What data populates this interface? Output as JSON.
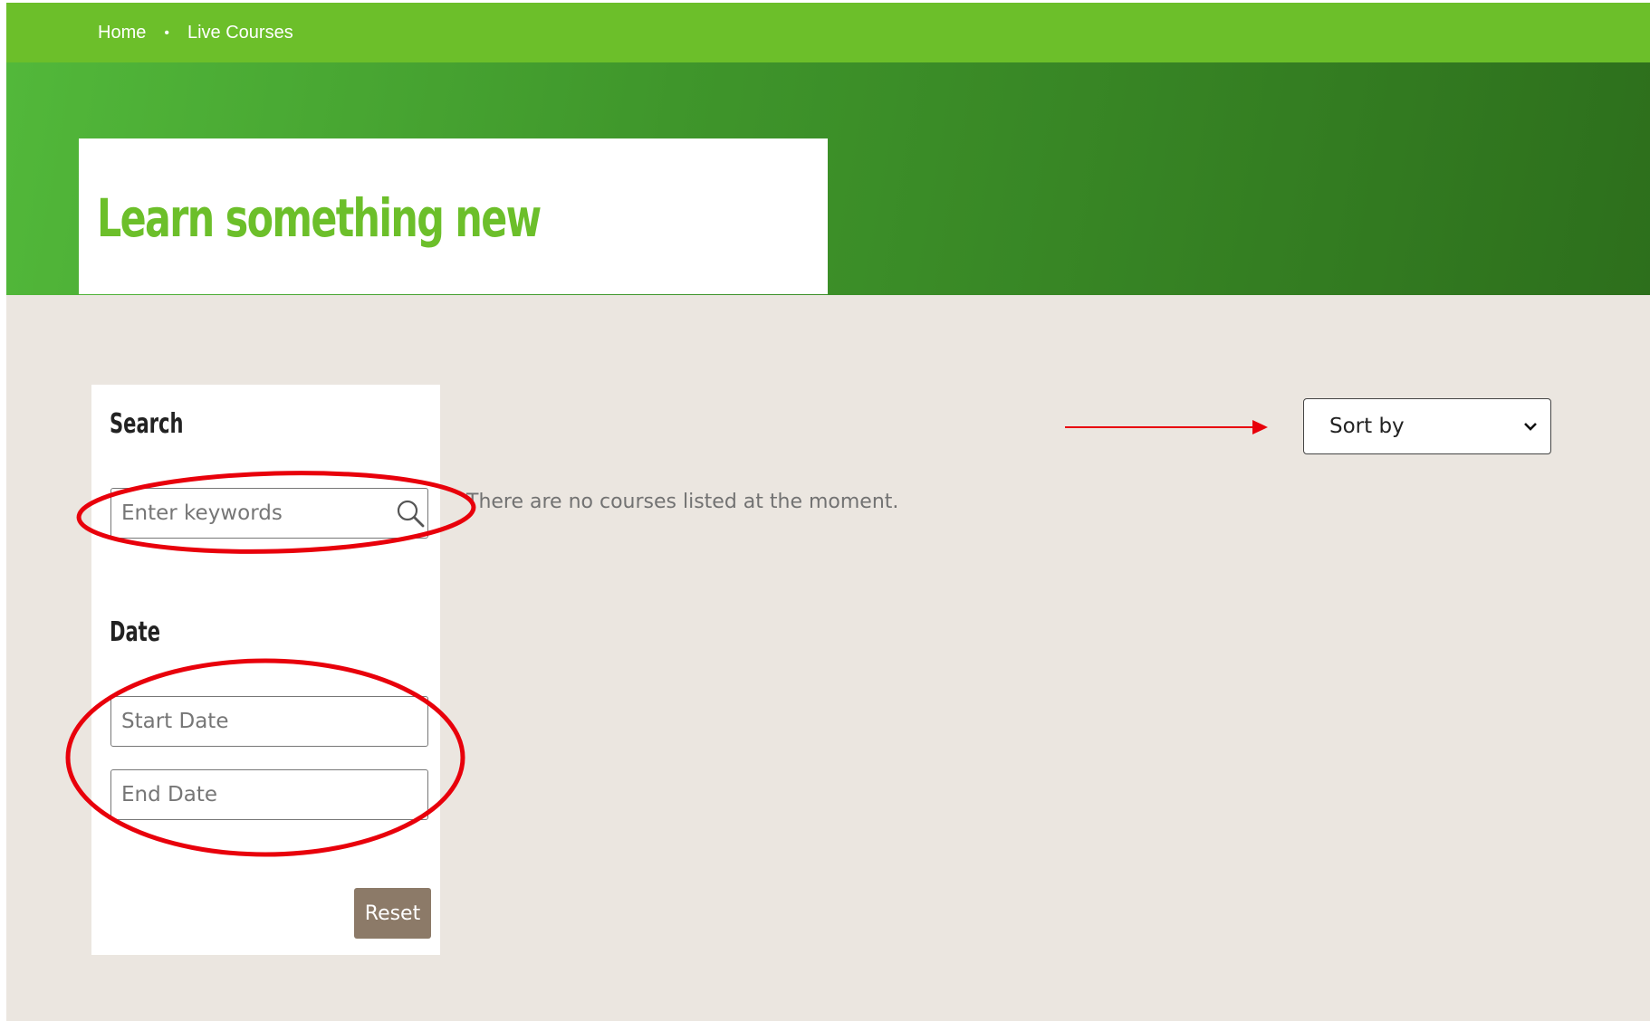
{
  "breadcrumb": {
    "home": "Home",
    "separator": "•",
    "current": "Live Courses"
  },
  "hero": {
    "title": "Learn something new"
  },
  "sidebar": {
    "search_heading": "Search",
    "search_placeholder": "Enter keywords",
    "date_heading": "Date",
    "start_date_placeholder": "Start Date",
    "end_date_placeholder": "End Date",
    "reset_label": "Reset"
  },
  "main": {
    "empty_message": "There are no courses listed at the moment.",
    "sort_label": "Sort by"
  },
  "colors": {
    "brand_green": "#6cbf2a",
    "hero_gradient_start": "#52b83a",
    "hero_gradient_end": "#2d6f1c",
    "page_background": "#ebe6e0",
    "reset_button": "#8c7a68",
    "annotation_red": "#e8000b"
  },
  "icons": {
    "search": "search-icon",
    "sort_dropdown": "chevron-down-icon"
  }
}
